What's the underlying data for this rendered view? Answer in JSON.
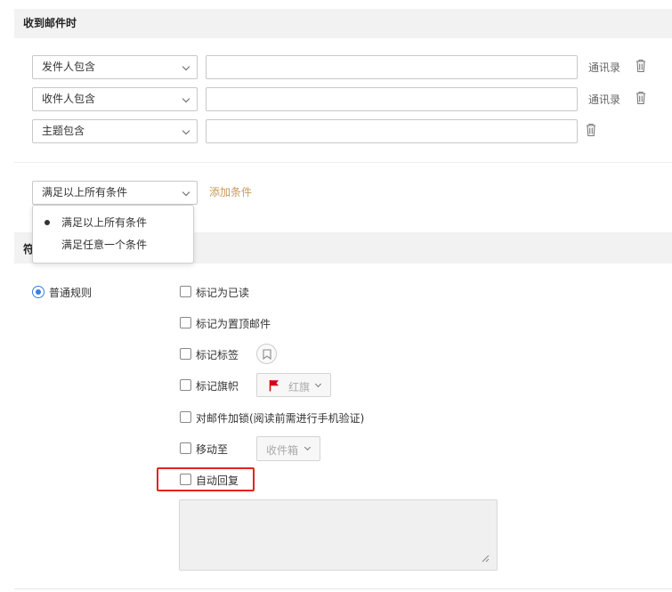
{
  "header": {
    "title": "收到邮件时"
  },
  "conditions": [
    {
      "field": "发件人包含",
      "value": "",
      "contacts_link": "通讯录"
    },
    {
      "field": "收件人包含",
      "value": "",
      "contacts_link": "通讯录"
    },
    {
      "field": "主题包含",
      "value": ""
    }
  ],
  "match": {
    "selected": "满足以上所有条件",
    "add_condition": "添加条件",
    "options": [
      "满足以上所有条件",
      "满足任意一个条件"
    ],
    "selected_index": 0
  },
  "section2": {
    "title_fragment": "符"
  },
  "rule_type": {
    "label": "普通规则",
    "selected": true
  },
  "actions": {
    "mark_read": {
      "label": "标记为已读",
      "checked": false
    },
    "mark_top": {
      "label": "标记为置顶邮件",
      "checked": false
    },
    "mark_tag": {
      "label": "标记标签",
      "checked": false
    },
    "mark_flag": {
      "label": "标记旗帜",
      "checked": false,
      "flag_value": "红旗",
      "flag_color": "#d0021b"
    },
    "lock_mail": {
      "label": "对邮件加锁(阅读前需进行手机验证)",
      "checked": false
    },
    "move_to": {
      "label": "移动至",
      "checked": false,
      "folder": "收件箱"
    },
    "auto_reply": {
      "label": "自动回复",
      "checked": false,
      "reply_text": ""
    }
  },
  "colors": {
    "accent": "#c79a5b",
    "radio": "#3a7ee6",
    "highlight": "#e5231b"
  }
}
